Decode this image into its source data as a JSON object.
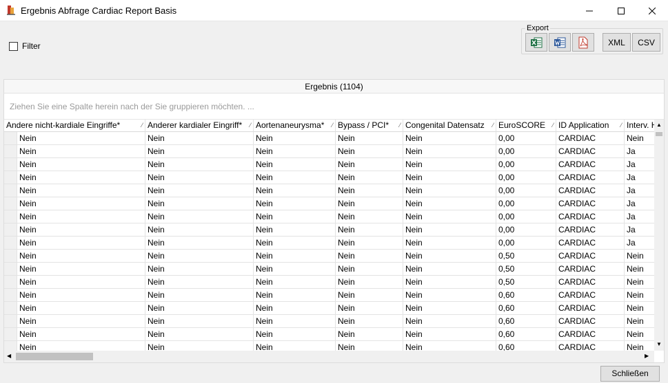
{
  "window": {
    "title": "Ergebnis Abfrage Cardiac Report Basis"
  },
  "filter": {
    "label": "Filter",
    "checked": false
  },
  "export": {
    "legend": "Export",
    "excel_icon": "excel-icon",
    "word_icon": "word-icon",
    "pdf_icon": "pdf-icon",
    "xml_label": "XML",
    "csv_label": "CSV"
  },
  "grid": {
    "caption": "Ergebnis (1104)",
    "group_hint": "Ziehen Sie eine Spalte herein  nach der Sie gruppieren möchten. ...",
    "columns": [
      "Andere nicht-kardiale Eingriffe*",
      "Anderer kardialer Eingriff*",
      "Aortenaneurysma*",
      "Bypass / PCI*",
      "Congenital Datensatz",
      "EuroSCORE",
      "ID Application",
      "Interv. H"
    ],
    "rows": [
      [
        "Nein",
        "Nein",
        "Nein",
        "Nein",
        "Nein",
        "0,00",
        "CARDIAC",
        "Nein"
      ],
      [
        "Nein",
        "Nein",
        "Nein",
        "Nein",
        "Nein",
        "0,00",
        "CARDIAC",
        "Ja"
      ],
      [
        "Nein",
        "Nein",
        "Nein",
        "Nein",
        "Nein",
        "0,00",
        "CARDIAC",
        "Ja"
      ],
      [
        "Nein",
        "Nein",
        "Nein",
        "Nein",
        "Nein",
        "0,00",
        "CARDIAC",
        "Ja"
      ],
      [
        "Nein",
        "Nein",
        "Nein",
        "Nein",
        "Nein",
        "0,00",
        "CARDIAC",
        "Ja"
      ],
      [
        "Nein",
        "Nein",
        "Nein",
        "Nein",
        "Nein",
        "0,00",
        "CARDIAC",
        "Ja"
      ],
      [
        "Nein",
        "Nein",
        "Nein",
        "Nein",
        "Nein",
        "0,00",
        "CARDIAC",
        "Ja"
      ],
      [
        "Nein",
        "Nein",
        "Nein",
        "Nein",
        "Nein",
        "0,00",
        "CARDIAC",
        "Ja"
      ],
      [
        "Nein",
        "Nein",
        "Nein",
        "Nein",
        "Nein",
        "0,00",
        "CARDIAC",
        "Ja"
      ],
      [
        "Nein",
        "Nein",
        "Nein",
        "Nein",
        "Nein",
        "0,50",
        "CARDIAC",
        "Nein"
      ],
      [
        "Nein",
        "Nein",
        "Nein",
        "Nein",
        "Nein",
        "0,50",
        "CARDIAC",
        "Nein"
      ],
      [
        "Nein",
        "Nein",
        "Nein",
        "Nein",
        "Nein",
        "0,50",
        "CARDIAC",
        "Nein"
      ],
      [
        "Nein",
        "Nein",
        "Nein",
        "Nein",
        "Nein",
        "0,60",
        "CARDIAC",
        "Nein"
      ],
      [
        "Nein",
        "Nein",
        "Nein",
        "Nein",
        "Nein",
        "0,60",
        "CARDIAC",
        "Nein"
      ],
      [
        "Nein",
        "Nein",
        "Nein",
        "Nein",
        "Nein",
        "0,60",
        "CARDIAC",
        "Nein"
      ],
      [
        "Nein",
        "Nein",
        "Nein",
        "Nein",
        "Nein",
        "0,60",
        "CARDIAC",
        "Nein"
      ],
      [
        "Nein",
        "Nein",
        "Nein",
        "Nein",
        "Nein",
        "0,60",
        "CARDIAC",
        "Nein"
      ]
    ]
  },
  "footer": {
    "close_label": "Schließen"
  }
}
